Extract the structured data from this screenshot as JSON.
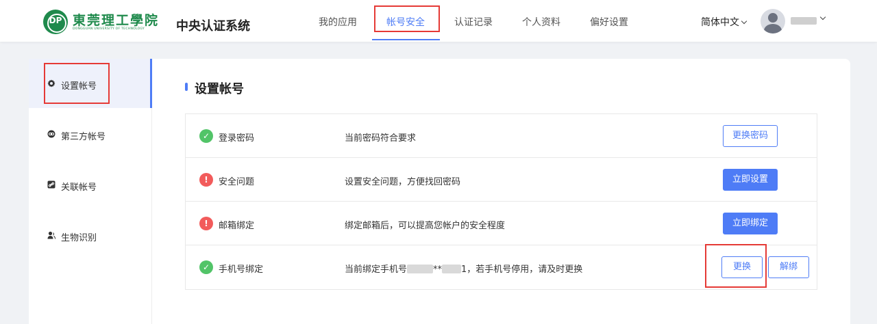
{
  "header": {
    "logo_text": "東莞理工學院",
    "logo_sub": "DONGGUAN UNIVERSITY OF TECHNOLOGY",
    "system_title": "中央认证系统",
    "nav": [
      {
        "label": "我的应用"
      },
      {
        "label": "帐号安全"
      },
      {
        "label": "认证记录"
      },
      {
        "label": "个人资料"
      },
      {
        "label": "偏好设置"
      }
    ],
    "active_nav": "帐号安全",
    "language": "简体中文"
  },
  "sidebar": {
    "items": [
      {
        "label": "设置帐号",
        "icon": "gear-icon"
      },
      {
        "label": "第三方帐号",
        "icon": "link-icon"
      },
      {
        "label": "关联帐号",
        "icon": "chain-icon"
      },
      {
        "label": "生物识别",
        "icon": "user-icon"
      }
    ],
    "active_item": "设置帐号"
  },
  "main": {
    "section_title": "设置帐号",
    "rows": [
      {
        "title": "登录密码",
        "desc": "当前密码符合要求",
        "status": "ok",
        "action": "更换密码"
      },
      {
        "title": "安全问题",
        "desc": "设置安全问题，方便找回密码",
        "status": "warn",
        "action": "立即设置"
      },
      {
        "title": "邮箱绑定",
        "desc": "绑定邮箱后，可以提高您帐户的安全程度",
        "status": "warn",
        "action": "立即绑定"
      },
      {
        "title": "手机号绑定",
        "desc_prefix": "当前绑定手机号",
        "desc_mid": "**",
        "desc_suffix": "1，若手机号停用，请及时更换",
        "status": "ok",
        "action": "更换",
        "action2": "解绑"
      }
    ]
  },
  "colors": {
    "accent": "#4e7cf6",
    "ok": "#52c468",
    "warn": "#f25b5b",
    "highlight": "#e53935",
    "logo": "#1f8a4c"
  }
}
